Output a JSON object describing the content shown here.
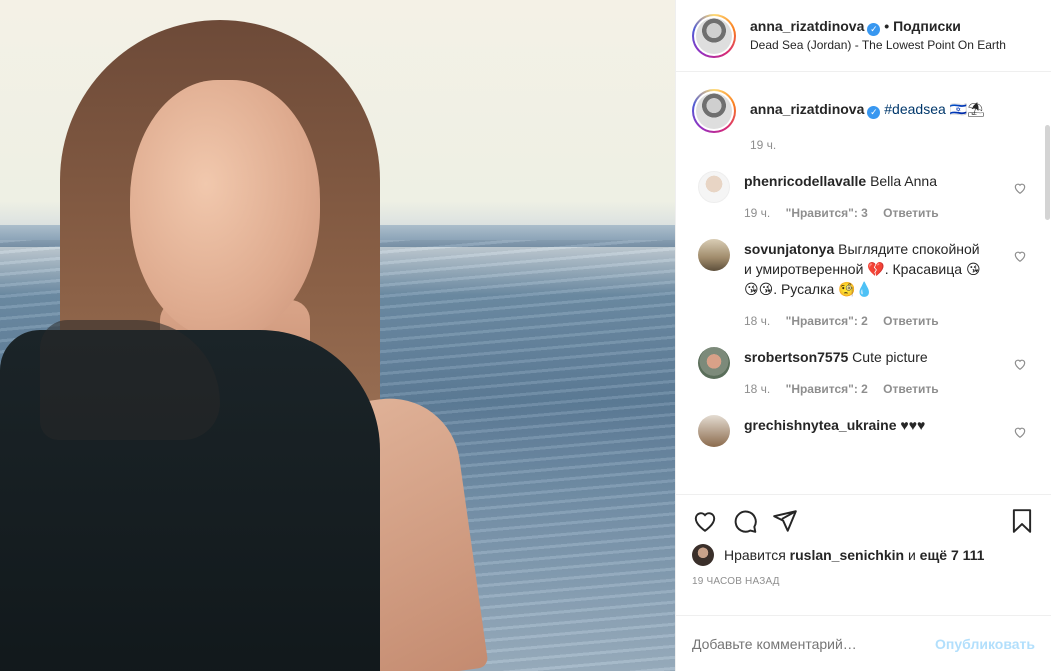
{
  "header": {
    "username": "anna_rizatdinova",
    "separator": "•",
    "follow_label": "Подписки",
    "location": "Dead Sea (Jordan) - The Lowest Point On Earth"
  },
  "caption": {
    "username": "anna_rizatdinova",
    "text": "#deadsea",
    "emoji": " 🇮🇱⛱",
    "time": "19 ч."
  },
  "comments": [
    {
      "username": "phenricodellavalle",
      "text": "Bella Anna",
      "time": "19 ч.",
      "likes": "\"Нравится\": 3",
      "reply": "Ответить"
    },
    {
      "username": "sovunjatonya",
      "text": "Выглядите спокойной и умиротверенной 💔. Красавица 😘😘😘. Русалка 🧐💧",
      "time": "18 ч.",
      "likes": "\"Нравится\": 2",
      "reply": "Ответить"
    },
    {
      "username": "srobertson7575",
      "text": "Cute picture",
      "time": "18 ч.",
      "likes": "\"Нравится\": 2",
      "reply": "Ответить"
    },
    {
      "username": "grechishnytea_ukraine",
      "text": "♥♥♥",
      "time": "",
      "likes": "",
      "reply": ""
    }
  ],
  "likes": {
    "prefix": "Нравится",
    "user": "ruslan_senichkin",
    "and": "и",
    "more": "ещё 7 111"
  },
  "post_time": "19 часов назад",
  "add_comment": {
    "placeholder": "Добавьте комментарий…",
    "submit_label": "Опубликовать"
  },
  "icons": {
    "like": "heart-icon",
    "comment": "comment-icon",
    "share": "share-icon",
    "save": "bookmark-icon",
    "verified": "verified-badge"
  },
  "colors": {
    "verified": "#3897f0",
    "hashtag": "#00376b",
    "post_button_disabled": "#b2dffc",
    "muted_text": "#8e8e8e"
  }
}
